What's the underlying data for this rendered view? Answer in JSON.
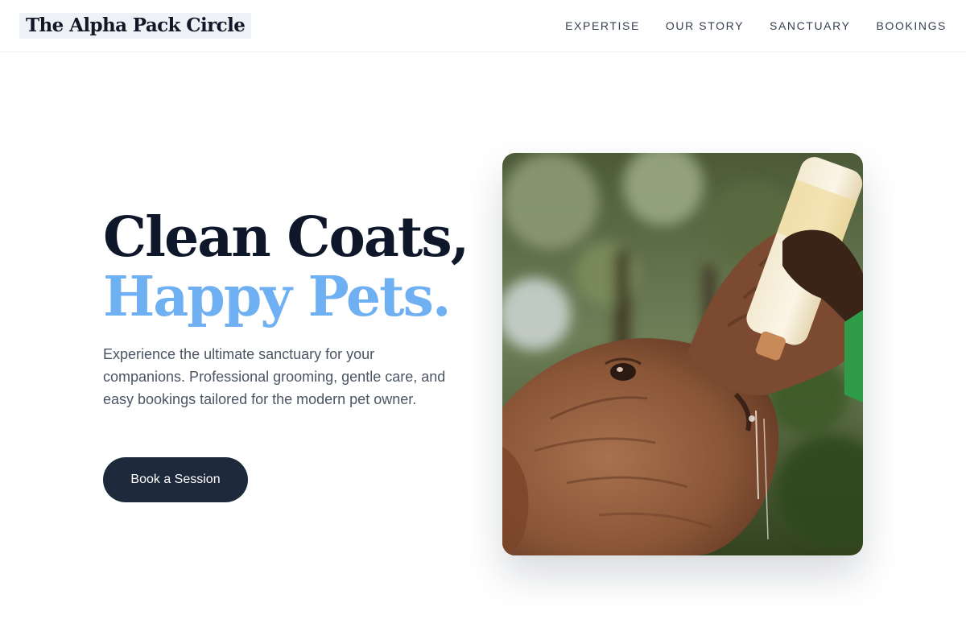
{
  "header": {
    "logo": "The Alpha Pack Circle",
    "nav": [
      "EXPERTISE",
      "OUR STORY",
      "SANCTUARY",
      "BOOKINGS"
    ]
  },
  "hero": {
    "headline_line1": "Clean Coats,",
    "headline_line2": "Happy Pets.",
    "description": "Experience the ultimate sanctuary for your companions. Professional grooming, gentle care, and easy bookings tailored for the modern pet owner.",
    "cta_label": "Book a Session",
    "image_subject": "baby elephant drinking from a milk bottle"
  },
  "colors": {
    "headline_dark": "#0f172a",
    "headline_accent": "#6fb0f2",
    "button_bg": "#1e293b",
    "body_text": "#4b5563"
  }
}
